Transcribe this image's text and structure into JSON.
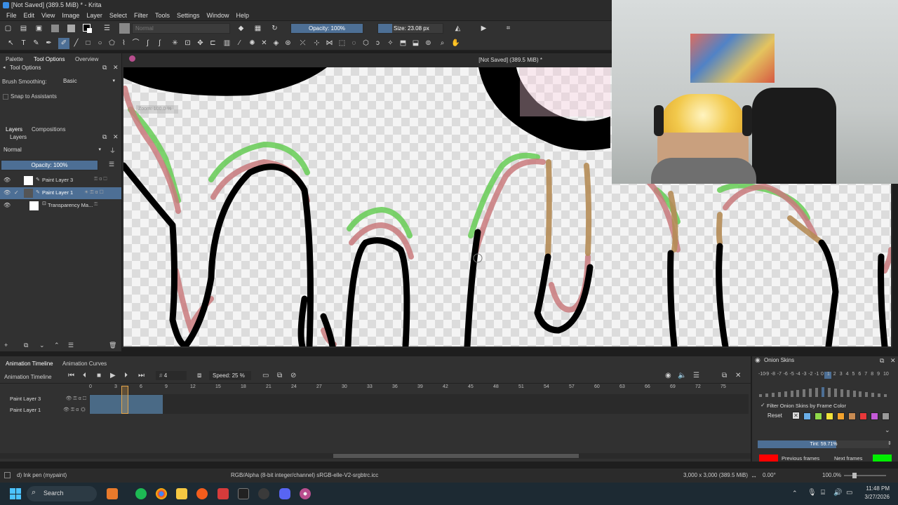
{
  "window": {
    "title": "[Not Saved]  (389.5 MiB) * - Krita"
  },
  "menu": [
    "File",
    "Edit",
    "View",
    "Image",
    "Layer",
    "Select",
    "Filter",
    "Tools",
    "Settings",
    "Window",
    "Help"
  ],
  "toolbar": {
    "blend_mode": "Normal",
    "opacity": "Opacity: 100%",
    "size": "Size: 23.08 px"
  },
  "left_dock": {
    "tabs": [
      "Palette",
      "Tool Options",
      "Overview"
    ],
    "tool_options_title": "Tool Options",
    "brush_smoothing_label": "Brush Smoothing:",
    "brush_smoothing_value": "Basic",
    "snap_label": "Snap to Assistants",
    "layer_tabs": [
      "Layers",
      "Compositions"
    ],
    "layers_title": "Layers",
    "layer_blend": "Normal",
    "layer_opacity": "Opacity:  100%",
    "layers": [
      {
        "name": "Paint Layer 3",
        "selected": false
      },
      {
        "name": "Paint Layer 1",
        "selected": true
      },
      {
        "name": "Transparency Ma...",
        "selected": false
      }
    ]
  },
  "canvas": {
    "doc_title": "[Not Saved]  (389.5 MiB) *",
    "zoom_hint": "Zoom: 100.0 %"
  },
  "timeline": {
    "tabs": [
      "Animation Timeline",
      "Animation Curves"
    ],
    "title": "Animation Timeline",
    "frame": "4",
    "speed": "Speed: 25 %",
    "layers": [
      "Paint Layer 3",
      "Paint Layer 1"
    ],
    "ruler": [
      "0",
      "3",
      "6",
      "9",
      "12",
      "15",
      "18",
      "21",
      "24",
      "27",
      "30",
      "33",
      "36",
      "39",
      "42",
      "45",
      "48",
      "51",
      "54",
      "57",
      "60",
      "63",
      "66",
      "69",
      "72",
      "75"
    ]
  },
  "onion": {
    "title": "Onion Skins",
    "numbers": [
      "-10",
      "-9",
      "-8",
      "-7",
      "-6",
      "-5",
      "-4",
      "-3",
      "-2",
      "-1",
      "0",
      "1",
      "2",
      "3",
      "4",
      "5",
      "6",
      "7",
      "8",
      "9",
      "10"
    ],
    "filter_label": "Filter Onion Skins by Frame Color",
    "reset_label": "Reset",
    "tint": "Tint: 59.71%",
    "tint_fraction": 0.5971,
    "previous_label": "Previous frames",
    "next_label": "Next frames",
    "previous_color": "#ff0000",
    "next_color": "#00ee00",
    "swatch_colors": [
      "#6aaee8",
      "#8fd94a",
      "#f0e23a",
      "#f2a22d",
      "#c78a52",
      "#e8383a",
      "#c45ad8",
      "#9a9a9a"
    ]
  },
  "status": {
    "brush": "d) Ink pen (mypaint)",
    "color_space": "RGB/Alpha (8-bit integer/channel)  sRGB-elle-V2-srgbtrc.icc",
    "dimensions": "3,000 x 3,000 (389.5 MiB)",
    "rotation": "0.00°",
    "zoom": "100.0%"
  },
  "taskbar": {
    "search": "Search",
    "time": "11:48 PM",
    "date": "3/27/2026"
  }
}
